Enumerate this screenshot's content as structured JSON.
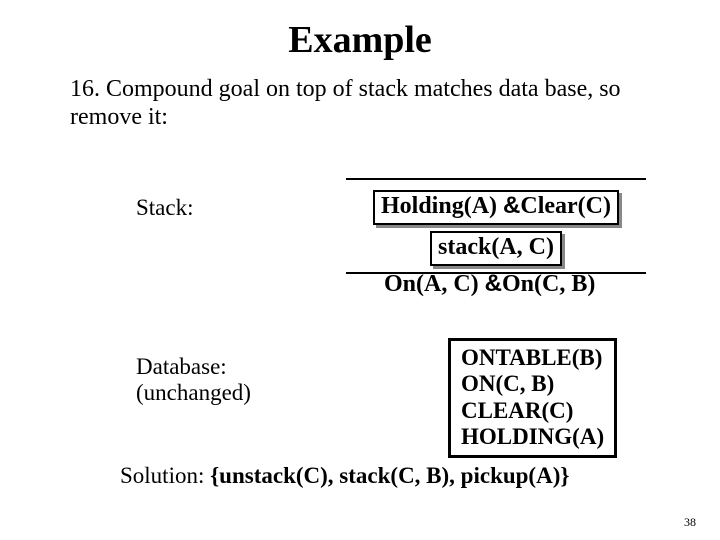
{
  "title": "Example",
  "body": "16. Compound goal on top of stack matches data base, so remove it:",
  "stack_label": "Stack:",
  "stack_item1": "Holding(A)",
  "amp": "&",
  "stack_item1b": "Clear(C)",
  "stack_item2": "stack(A, C)",
  "goal_left": "On(A, C)",
  "goal_right": "On(C, B)",
  "db_label_line1": "Database:",
  "db_label_line2": "(unchanged)",
  "db_lines": {
    "l1": "ONTABLE(B)",
    "l2": "ON(C, B)",
    "l3": "CLEAR(C)",
    "l4": "HOLDING(A)"
  },
  "solution_label": "Solution: ",
  "solution_value": "{unstack(C), stack(C, B), pickup(A)}",
  "page_number": "38"
}
